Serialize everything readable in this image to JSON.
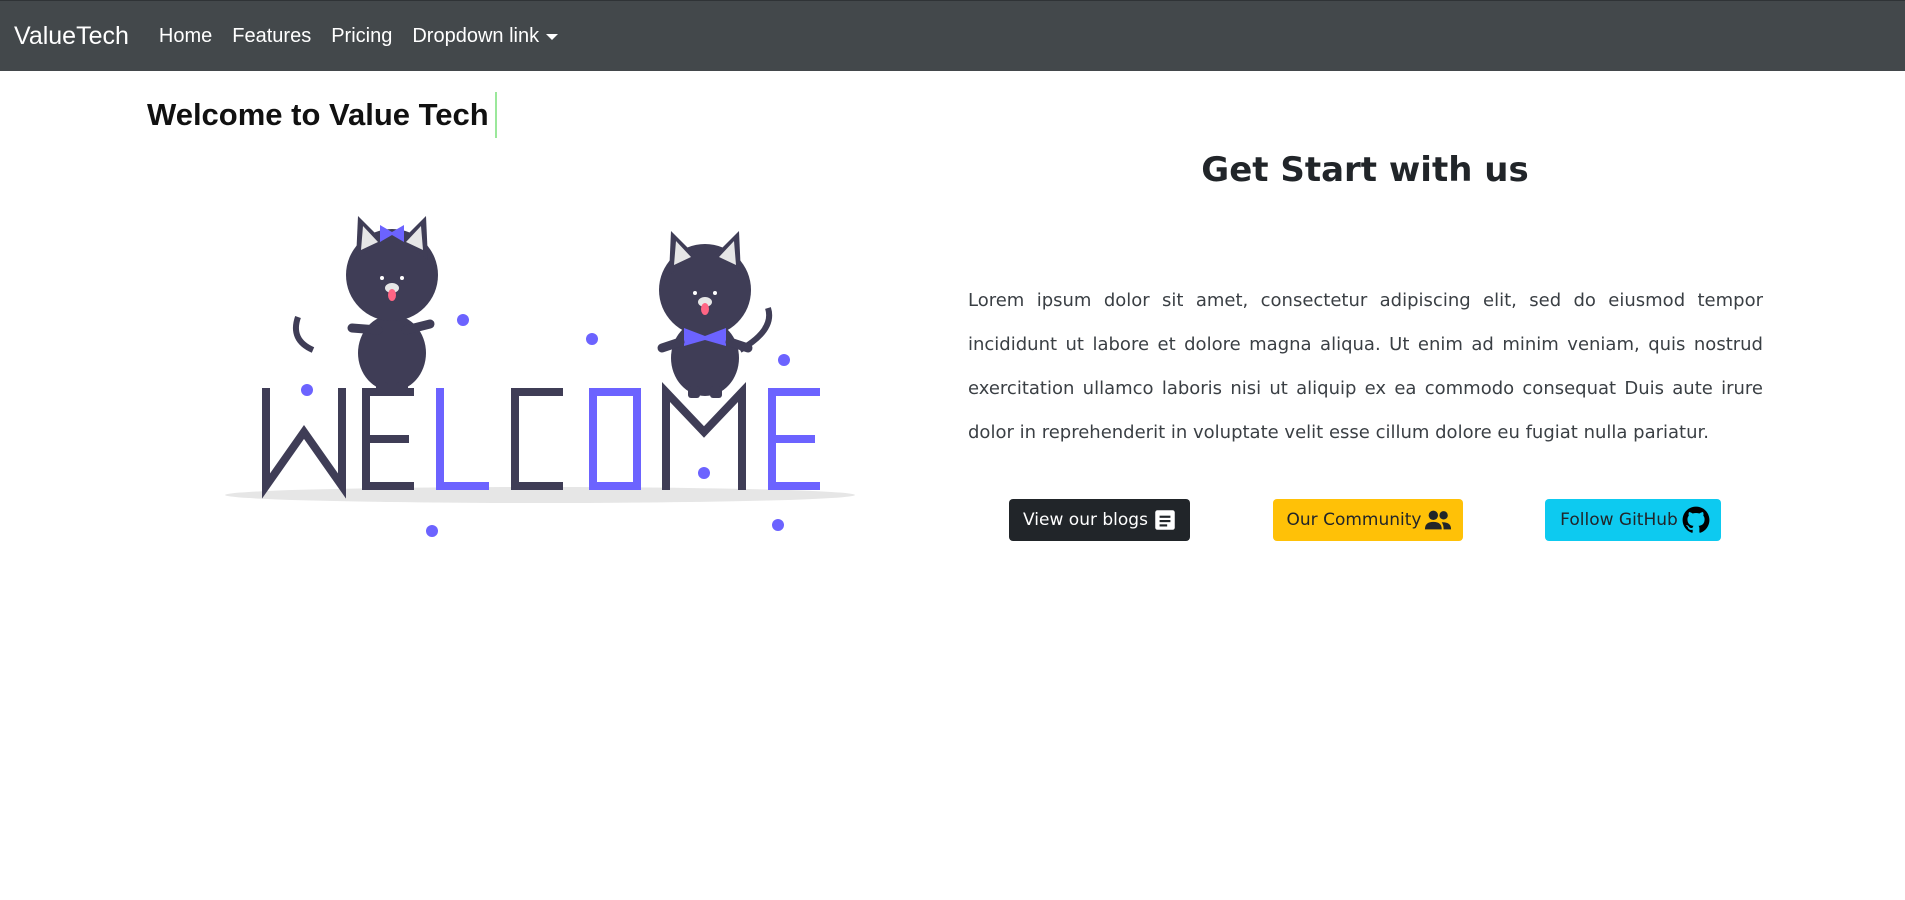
{
  "navbar": {
    "brand": "ValueTech",
    "links": [
      "Home",
      "Features",
      "Pricing"
    ],
    "dropdown_label": "Dropdown link"
  },
  "hero": {
    "heading": "Welcome to Value Tech",
    "illustration": {
      "icon": "welcome-cats-illustration",
      "letters": [
        "W",
        "E",
        "L",
        "C",
        "O",
        "M",
        "E"
      ]
    }
  },
  "intro": {
    "title": "Get Start with us",
    "body": "Lorem ipsum dolor sit amet, consectetur adipiscing elit, sed do eiusmod tempor incididunt ut labore et dolore magna aliqua. Ut enim ad minim veniam, quis nostrud exercitation ullamco laboris nisi ut aliquip ex ea commodo consequat Duis aute irure dolor in reprehenderit in voluptate velit esse cillum dolore eu fugiat nulla pariatur."
  },
  "buttons": {
    "blogs": {
      "label": "View our blogs",
      "icon": "document-icon"
    },
    "community": {
      "label": "Our Community",
      "icon": "people-icon"
    },
    "github": {
      "label": "Follow GitHub",
      "icon": "github-icon"
    }
  },
  "colors": {
    "navbar": "#43484b",
    "accent": "#6c63ff",
    "dark_figure": "#3f3d56",
    "btn_dark": "#212529",
    "btn_warning": "#ffc107",
    "btn_info": "#0dcaf0"
  }
}
